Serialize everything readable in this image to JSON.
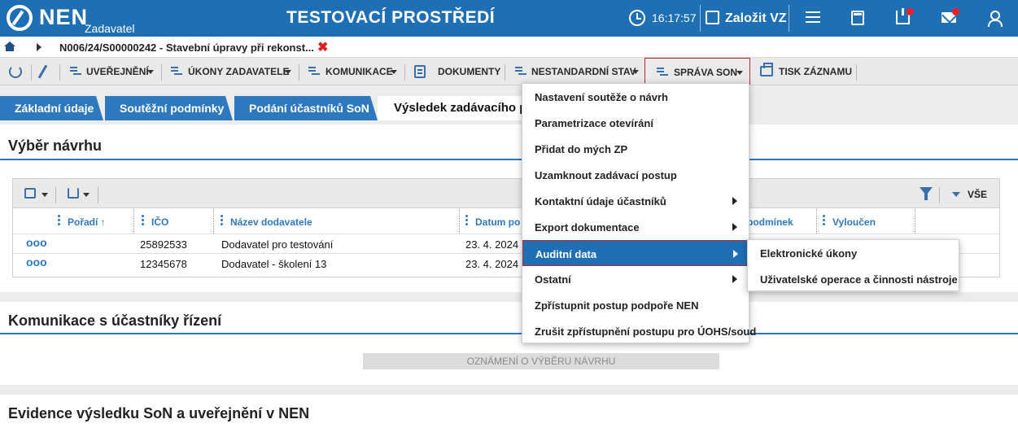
{
  "header": {
    "logo": "NEN",
    "role": "Zadavatel",
    "environment": "TESTOVACÍ PROSTŘEDÍ",
    "time": "16:17:57",
    "create_vz": "Založit VZ",
    "icons": [
      "clock-icon",
      "edit-icon",
      "menu-icon",
      "calculator-icon",
      "inbox-icon",
      "mail-icon",
      "user-icon"
    ],
    "notification_color": "#e8202a",
    "brand_color": "#1f6fb5"
  },
  "breadcrumb": {
    "text": "N006/24/S00000242 - Stavební úpravy při rekonst...",
    "close": "✖"
  },
  "toolbar": {
    "uverejneni": "UVEŘEJNĚNÍ",
    "ukony": "ÚKONY ZADAVATELE",
    "komunikace": "KOMUNIKACE",
    "dokumenty": "DOKUMENTY",
    "nestandardni": "NESTANDARDNÍ STAV",
    "sprava": "SPRÁVA SON",
    "tisk": "TISK ZÁZNAMU"
  },
  "tabs": [
    {
      "label": "Základní údaje"
    },
    {
      "label": "Soutěžní podmínky"
    },
    {
      "label": "Podání účastníků SoN"
    },
    {
      "label": "Výsledek zadávacího po"
    }
  ],
  "vyber": {
    "title": "Výběr návrhu",
    "filter_all": "VŠE",
    "columns": [
      "Pořadí ↑",
      "IČO",
      "Název dodavatele",
      "Datum po",
      "podmínek",
      "Vyloučen"
    ],
    "rows": [
      {
        "more": "ooo",
        "ico": "25892533",
        "name": "Dodavatel pro testování",
        "date": "23. 4. 2024"
      },
      {
        "more": "ooo",
        "ico": "12345678",
        "name": "Dodavatel - školení 13",
        "date": "23. 4. 2024"
      }
    ]
  },
  "komunikace": {
    "title": "Komunikace s účastníky řízení",
    "notice_button": "OZNÁMENÍ O VÝBĚRU NÁVRHU"
  },
  "evidence": {
    "title": "Evidence výsledku SoN a uveřejnění v NEN"
  },
  "menu": {
    "items": [
      {
        "label": "Nastavení soutěže o návrh",
        "submenu": false
      },
      {
        "label": "Parametrizace otevírání",
        "submenu": false
      },
      {
        "label": "Přidat do mých ZP",
        "submenu": false
      },
      {
        "label": "Uzamknout zadávací postup",
        "submenu": false
      },
      {
        "label": "Kontaktní údaje účastníků",
        "submenu": true
      },
      {
        "label": "Export dokumentace",
        "submenu": true
      },
      {
        "label": "Auditní data",
        "submenu": true
      },
      {
        "label": "Ostatní",
        "submenu": true
      },
      {
        "label": "Zpřístupnit postup podpoře NEN",
        "submenu": false
      },
      {
        "label": "Zrušit zpřístupnění postupu pro ÚOHS/soud",
        "submenu": false
      }
    ],
    "active_index": 6
  },
  "submenu": {
    "items": [
      {
        "label": "Elektronické úkony"
      },
      {
        "label": "Uživatelské operace a činnosti nástroje"
      }
    ]
  }
}
